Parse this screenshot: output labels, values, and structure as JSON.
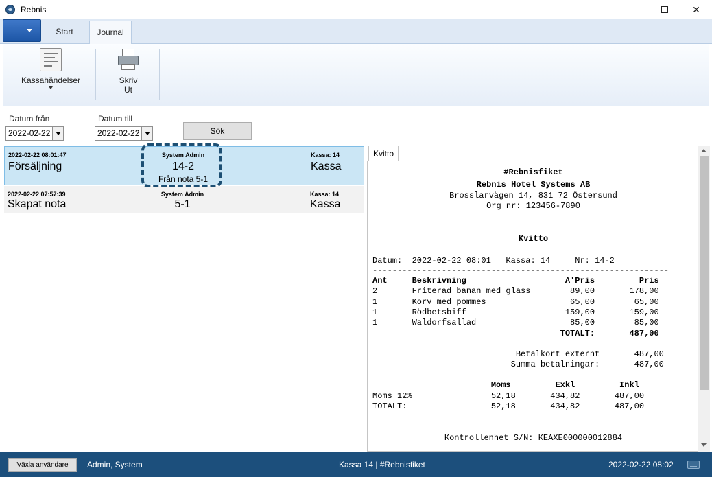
{
  "window": {
    "title": "Rebnis",
    "icon": "rebnis-logo-icon"
  },
  "ribbon": {
    "tabs": [
      {
        "label": "Start"
      },
      {
        "label": "Journal"
      }
    ],
    "buttons": {
      "kassahandelser": "Kassahändelser",
      "skriv": "Skriv",
      "ut": "Ut"
    }
  },
  "filters": {
    "from_label": "Datum från",
    "from_value": "2022-02-22",
    "to_label": "Datum till",
    "to_value": "2022-02-22",
    "search_label": "Sök"
  },
  "journal": {
    "rows": [
      {
        "time": "2022-02-22 08:01:47",
        "type": "Försäljning",
        "user": "System Admin",
        "number": "14-2",
        "from": "Från nota 5-1",
        "kassa_small": "Kassa: 14",
        "kassa": "Kassa"
      },
      {
        "time": "2022-02-22 07:57:39",
        "type": "Skapat nota",
        "user": "System Admin",
        "number": "5-1",
        "kassa_small": "Kassa: 14",
        "kassa": "Kassa"
      }
    ]
  },
  "receipt": {
    "tab": "Kvitto",
    "shop": "#Rebnisfiket",
    "company": "Rebnis Hotel Systems AB",
    "address": "Brosslarvägen 14, 831 72 Östersund",
    "org": "Org nr: 123456-7890",
    "heading": "Kvitto",
    "info": "Datum:  2022-02-22 08:01   Kassa: 14     Nr: 14-2",
    "divider": "------------------------------------------------------------",
    "col_headers": "Ant     Beskrivning                    A'Pris         Pris",
    "items": [
      "2       Friterad banan med glass        89,00       178,00",
      "1       Korv med pommes                 65,00        65,00",
      "1       Rödbetsbiff                    159,00       159,00",
      "1       Waldorfsallad                   85,00        85,00"
    ],
    "total": "                                      TOTALT:       487,00",
    "pay1": "                             Betalkort externt       487,00",
    "pay2": "                            Summa betalningar:       487,00",
    "vat_header": "                        Moms         Exkl         Inkl",
    "vat1": "Moms 12%                52,18       434,82       487,00",
    "vat2": "TOTALT:                 52,18       434,82       487,00",
    "control": "Kontrollenhet S/N: KEAXE000000012884"
  },
  "statusbar": {
    "switch_user": "Växla användare",
    "user": "Admin, System",
    "center": "Kassa 14 | #Rebnisfiket",
    "time": "2022-02-22 08:02"
  },
  "colors": {
    "statusbar": "#1c4f7c",
    "selected_row": "#cbe6f5",
    "highlight": "#1d4f73"
  }
}
